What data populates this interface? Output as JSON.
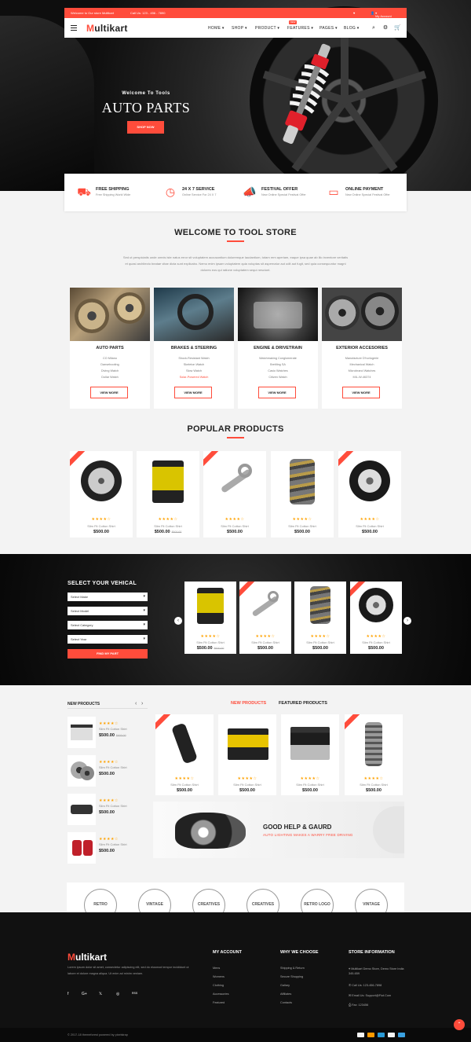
{
  "topbar": {
    "welcome": "Welcome to Our store Multikart",
    "phone": "Call Us: 123 - 456 - 7890",
    "account": "My Account"
  },
  "logo": {
    "m": "M",
    "rest": "ultikart"
  },
  "nav": {
    "items": [
      "HOME",
      "SHOP",
      "PRODUCT",
      "FEATURES",
      "PAGES",
      "BLOG"
    ],
    "new_tag": "NEW"
  },
  "hero": {
    "subtitle": "Welcome To Tools",
    "title": "AUTO PARTS",
    "button": "SHOP NOW"
  },
  "services": [
    {
      "title": "FREE SHIPPING",
      "desc": "Free Shipping World Wide",
      "icon": "truck-icon"
    },
    {
      "title": "24 X 7 SERVICE",
      "desc": "Online Service For 24 X 7",
      "icon": "clock-icon"
    },
    {
      "title": "FESTIVAL OFFER",
      "desc": "New Online Special Festival Offer",
      "icon": "megaphone-icon"
    },
    {
      "title": "ONLINE PAYMENT",
      "desc": "New Online Special Festival Offer",
      "icon": "card-icon"
    }
  ],
  "welcome_section": {
    "title": "WELCOME TO TOOL STORE",
    "text": "Sed ut perspiciatis unde omnis iste natus error sit voluptatem accusantium doloremque laudantium, totam rem aperiam, eaque ipsa quae ab illo inventore veritatis et quasi architecto beatae vitae dicta sunt explicabo. Nemo enim ipsam voluptatem quia voluptas sit aspernatur aut odit aut fugit, sed quia consequuntur magni dolores eos qui ratione voluptatem sequi nesciunt."
  },
  "categories": [
    {
      "title": "AUTO PARTS",
      "items": [
        "CO Milano",
        "Dansebooting",
        "Diving Watch",
        "Dollar Watch"
      ],
      "button": "VIEW MORE"
    },
    {
      "title": "BRAKES & STEERING",
      "items": [
        "Shock-Resistant Watch",
        "Skeleton Watch",
        "Slow Watch",
        "Solar-Powered Watch"
      ],
      "button": "VIEW MORE"
    },
    {
      "title": "ENGINE & DRIVETRAIN",
      "items": [
        "Watchmaking Conglomerate",
        "Breitling SA",
        "Casio Watches",
        "Citizen Watch"
      ],
      "button": "VIEW MORE"
    },
    {
      "title": "EXTERIOR ACCESORIES",
      "items": [
        "Manufacture D'horlogerie",
        "Mechanical Watch",
        "Microbrand Watches",
        "MIL-W-46374"
      ],
      "button": "VIEW MORE"
    }
  ],
  "popular": {
    "title": "POPULAR PRODUCTS",
    "products": [
      {
        "name": "Slim Fit Cotton Shirt",
        "price": "$500.00",
        "old": "",
        "stars": "★★★★☆",
        "ribbon": "new"
      },
      {
        "name": "Slim Fit Cotton Shirt",
        "price": "$500.00",
        "old": "$600.00",
        "stars": "★★★★☆",
        "ribbon": ""
      },
      {
        "name": "Slim Fit Cotton Shirt",
        "price": "$500.00",
        "old": "",
        "stars": "★★★★☆",
        "ribbon": "new"
      },
      {
        "name": "Slim Fit Cotton Shirt",
        "price": "$500.00",
        "old": "",
        "stars": "★★★★☆",
        "ribbon": ""
      },
      {
        "name": "Slim Fit Cotton Shirt",
        "price": "$500.00",
        "old": "",
        "stars": "★★★★☆",
        "ribbon": "new"
      }
    ]
  },
  "vehicle": {
    "title": "SELECT YOUR VEHICAL",
    "selects": [
      "Select Make",
      "Select Model",
      "Select Category",
      "Select Year"
    ],
    "button": "FIND MY PART"
  },
  "vehicle_products": [
    {
      "name": "Slim Fit Cotton Shirt",
      "price": "$500.00",
      "old": "$600.00",
      "stars": "★★★★☆"
    },
    {
      "name": "Slim Fit Cotton Shirt",
      "price": "$500.00",
      "old": "",
      "stars": "★★★★☆"
    },
    {
      "name": "Slim Fit Cotton Shirt",
      "price": "$500.00",
      "old": "",
      "stars": "★★★★☆"
    },
    {
      "name": "Slim Fit Cotton Shirt",
      "price": "$500.00",
      "old": "",
      "stars": "★★★★☆"
    }
  ],
  "new_products": {
    "title": "NEW PRODUCTS",
    "items": [
      {
        "name": "Slim Fit Cotton Shirt",
        "price": "$500.00",
        "old": "$600.00",
        "stars": "★★★★☆"
      },
      {
        "name": "Slim Fit Cotton Shirt",
        "price": "$500.00",
        "old": "",
        "stars": "★★★★☆"
      },
      {
        "name": "Slim Fit Cotton Shirt",
        "price": "$500.00",
        "old": "",
        "stars": "★★★★☆"
      },
      {
        "name": "Slim Fit Cotton Shirt",
        "price": "$500.00",
        "old": "",
        "stars": "★★★★☆"
      }
    ]
  },
  "tabs": {
    "new": "NEW PRODUCTS",
    "featured": "FEATURED PRODUCTS"
  },
  "featured_products": [
    {
      "name": "Slim Fit Cotton Shirt",
      "price": "$500.00",
      "stars": "★★★★☆"
    },
    {
      "name": "Slim Fit Cotton Shirt",
      "price": "$500.00",
      "stars": "★★★★☆"
    },
    {
      "name": "Slim Fit Cotton Shirt",
      "price": "$500.00",
      "stars": "★★★★☆"
    },
    {
      "name": "Slim Fit Cotton Shirt",
      "price": "$500.00",
      "stars": "★★★★☆"
    }
  ],
  "banner": {
    "title": "GOOD HELP & GAURD",
    "subtitle": "AUTO LIGHTING MAKES A WARRY FREE DRIVING"
  },
  "brands": [
    "RETRO",
    "VINTAGE",
    "CREATIVES",
    "CREATIVES",
    "RETRO LOGO",
    "VINTAGE"
  ],
  "footer": {
    "about": "Lorem ipsum dolor sit amet, consectetur adipiscing elit, sed do eiusmod tempor incididunt ut labore et dolore magna aliqua. Ut enim ad minim veniam.",
    "social": [
      "f",
      "G+",
      "𝕏",
      "◎",
      "RSS"
    ],
    "my_account": {
      "title": "MY ACCOUNT",
      "links": [
        "Mens",
        "Womens",
        "Clothing",
        "Accessories",
        "Featured"
      ]
    },
    "why": {
      "title": "WHY WE CHOOSE",
      "links": [
        "Shipping & Return",
        "Secure Shopping",
        "Gallary",
        "Affiliates",
        "Contacts"
      ]
    },
    "store": {
      "title": "STORE INFORMATION",
      "lines": [
        "Multikart Demo Store, Demo Store India 345-659",
        "Call Us: 123-456-7898",
        "Email Us: Support@Fiot.Com",
        "Fax: 123456"
      ]
    },
    "copyright": "© 2017-18 themeforest powered by pixelstrap"
  },
  "colors": {
    "accent": "#ff4c3b",
    "dark": "#111111",
    "star": "#ffa200"
  }
}
